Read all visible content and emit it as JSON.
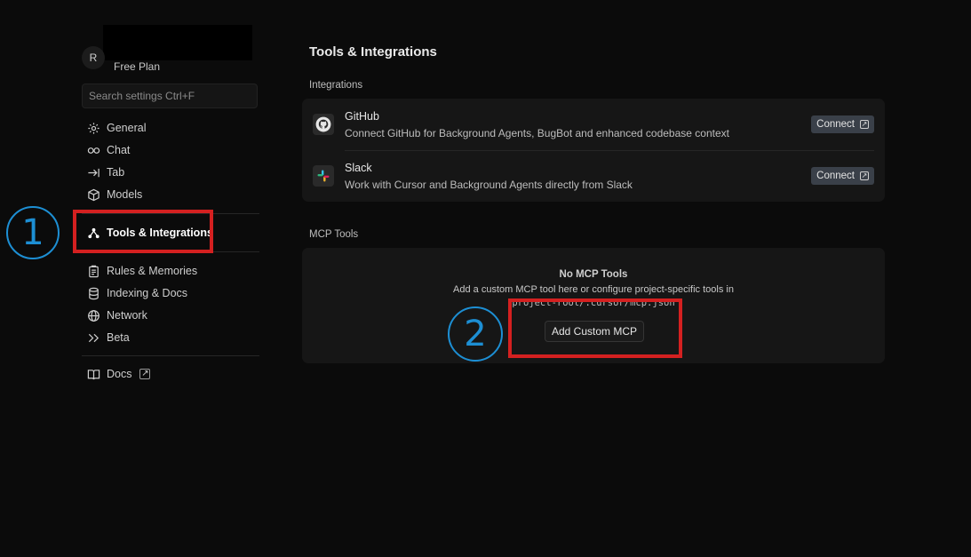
{
  "user": {
    "avatar_letter": "R",
    "plan": "Free Plan"
  },
  "search": {
    "placeholder": "Search settings Ctrl+F"
  },
  "sidebar": {
    "items": [
      {
        "label": "General",
        "icon": "gear-icon"
      },
      {
        "label": "Chat",
        "icon": "infinity-icon"
      },
      {
        "label": "Tab",
        "icon": "tab-arrow-icon"
      },
      {
        "label": "Models",
        "icon": "cube-icon"
      },
      {
        "label": "Tools & Integrations",
        "icon": "tools-icon",
        "active": true
      },
      {
        "label": "Rules & Memories",
        "icon": "clipboard-icon"
      },
      {
        "label": "Indexing & Docs",
        "icon": "database-icon"
      },
      {
        "label": "Network",
        "icon": "globe-icon"
      },
      {
        "label": "Beta",
        "icon": "double-chevron-icon"
      },
      {
        "label": "Docs",
        "icon": "book-icon",
        "external": true
      }
    ]
  },
  "main": {
    "title": "Tools & Integrations",
    "integrations_label": "Integrations",
    "integrations": [
      {
        "name": "GitHub",
        "description": "Connect GitHub for Background Agents, BugBot and enhanced codebase context",
        "button": "Connect",
        "icon": "github-icon"
      },
      {
        "name": "Slack",
        "description": "Work with Cursor and Background Agents directly from Slack",
        "button": "Connect",
        "icon": "slack-icon"
      }
    ],
    "mcp_label": "MCP Tools",
    "mcp": {
      "empty_title": "No MCP Tools",
      "empty_desc": "Add a custom MCP tool here or configure project-specific tools in",
      "path": "project-root/.cursor/mcp.json",
      "add_button": "Add Custom MCP"
    }
  },
  "annotations": {
    "step1": "1",
    "step2": "2"
  },
  "colors": {
    "annotation_box": "#d42020",
    "annotation_circle": "#1d8fd4",
    "connect_button": "#3a4049"
  }
}
